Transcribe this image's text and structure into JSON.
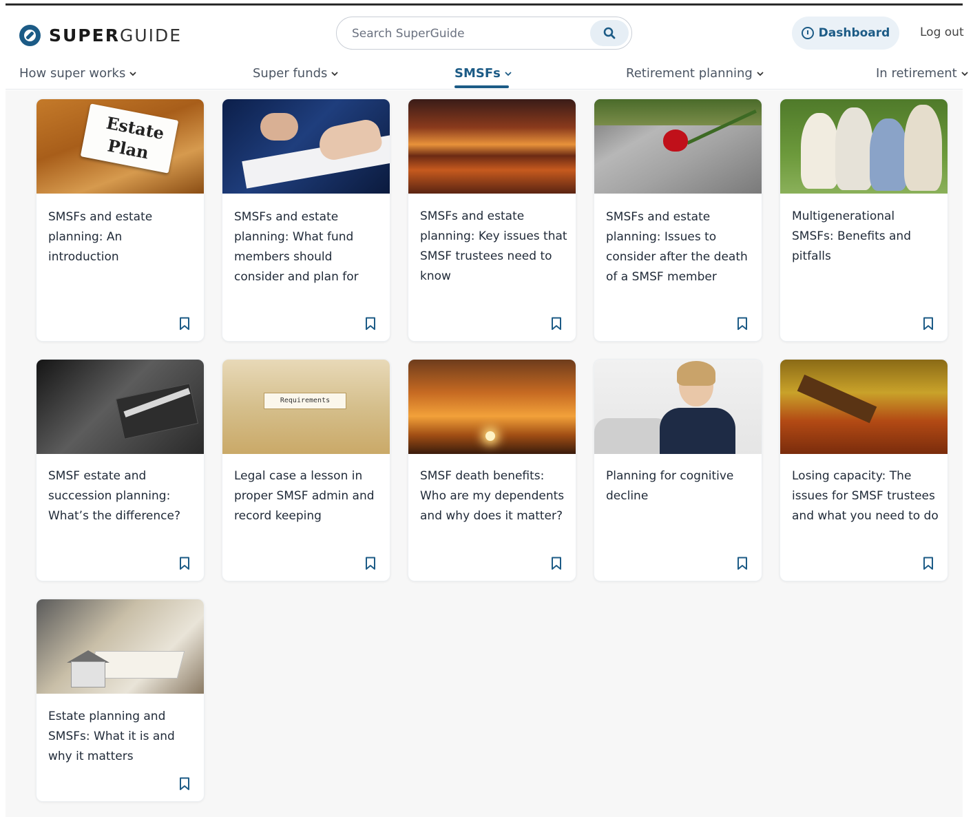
{
  "brand": {
    "bold": "SUPER",
    "light": "GUIDE"
  },
  "search": {
    "placeholder": "Search SuperGuide"
  },
  "header": {
    "dashboard_label": "Dashboard",
    "logout_label": "Log out"
  },
  "nav": {
    "items": [
      {
        "label": "How super works"
      },
      {
        "label": "Super funds"
      },
      {
        "label": "SMSFs",
        "active": true
      },
      {
        "label": "Retirement planning"
      },
      {
        "label": "In retirement"
      }
    ]
  },
  "articles": [
    {
      "title": "SMSFs and estate planning: An introduction",
      "image_text": [
        "Estate",
        "Plan"
      ]
    },
    {
      "title": "SMSFs and estate planning: What fund members should consider and plan for"
    },
    {
      "title": "SMSFs and estate planning: Key issues that SMSF trustees need to know"
    },
    {
      "title": "SMSFs and estate planning: Issues to consider after the death of a SMSF member"
    },
    {
      "title": "Multigenerational SMSFs: Benefits and pitfalls"
    },
    {
      "title": "SMSF estate and succession planning: What’s the difference?"
    },
    {
      "title": "Legal case a lesson in proper SMSF admin and record keeping",
      "image_text": [
        "Requirements"
      ]
    },
    {
      "title": "SMSF death benefits: Who are my dependents and why does it matter?"
    },
    {
      "title": "Planning for cognitive decline"
    },
    {
      "title": "Losing capacity: The issues for SMSF trustees and what you need to do"
    },
    {
      "title": "Estate planning and SMSFs: What it is and why it matters"
    }
  ],
  "colors": {
    "brand": "#1c5b86",
    "page_bg": "#f7f7f7",
    "card_bg": "#ffffff"
  },
  "icons": {
    "search": "search-icon",
    "dashboard": "dashboard-icon",
    "chevron": "chevron-down-icon",
    "bookmark": "bookmark-icon"
  }
}
